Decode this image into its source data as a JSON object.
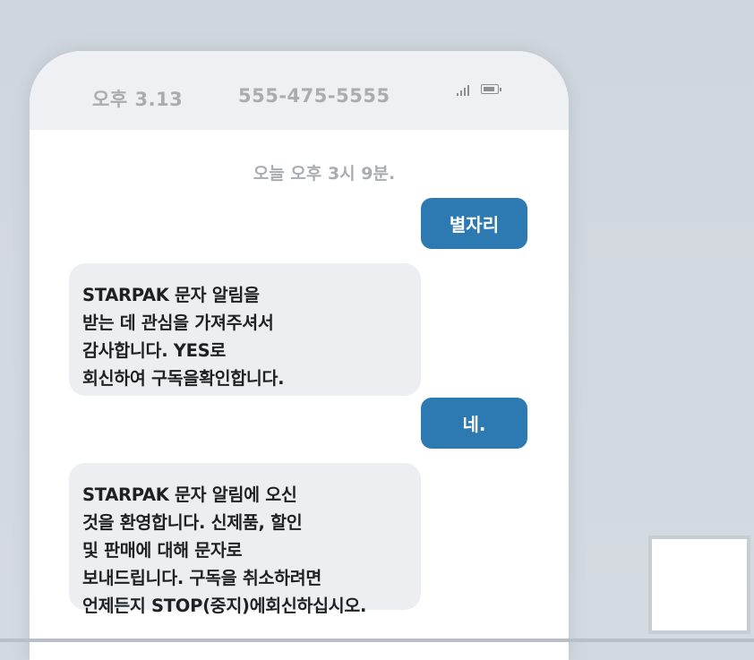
{
  "status_bar": {
    "time": "오후 3.13",
    "phone_number": "555-475-5555",
    "signal_icon": "signal-icon",
    "battery_icon": "battery-icon"
  },
  "thread": {
    "date_label": "오늘 오후 3시 9분.",
    "messages": [
      {
        "direction": "outgoing",
        "text": "별자리"
      },
      {
        "direction": "incoming",
        "lines": [
          "STARPAK 문자 알림을",
          "받는 데 관심을 가져주셔서",
          "감사합니다. YES로",
          "회신하여 구독을확인합니다."
        ]
      },
      {
        "direction": "outgoing",
        "text": "네."
      },
      {
        "direction": "incoming",
        "lines": [
          "STARPAK 문자 알림에 오신",
          "것을 환영합니다. 신제품, 할인",
          "및 판매에 대해 문자로",
          "보내드립니다. 구독을 취소하려면",
          "언제든지 STOP(중지)에회신하십시오."
        ]
      }
    ]
  },
  "colors": {
    "background": "#d2d8df",
    "status_bar": "#eef0f3",
    "outgoing_bubble": "#2d7ab3",
    "incoming_bubble": "#eceef2",
    "muted_text": "#a9adb2"
  }
}
